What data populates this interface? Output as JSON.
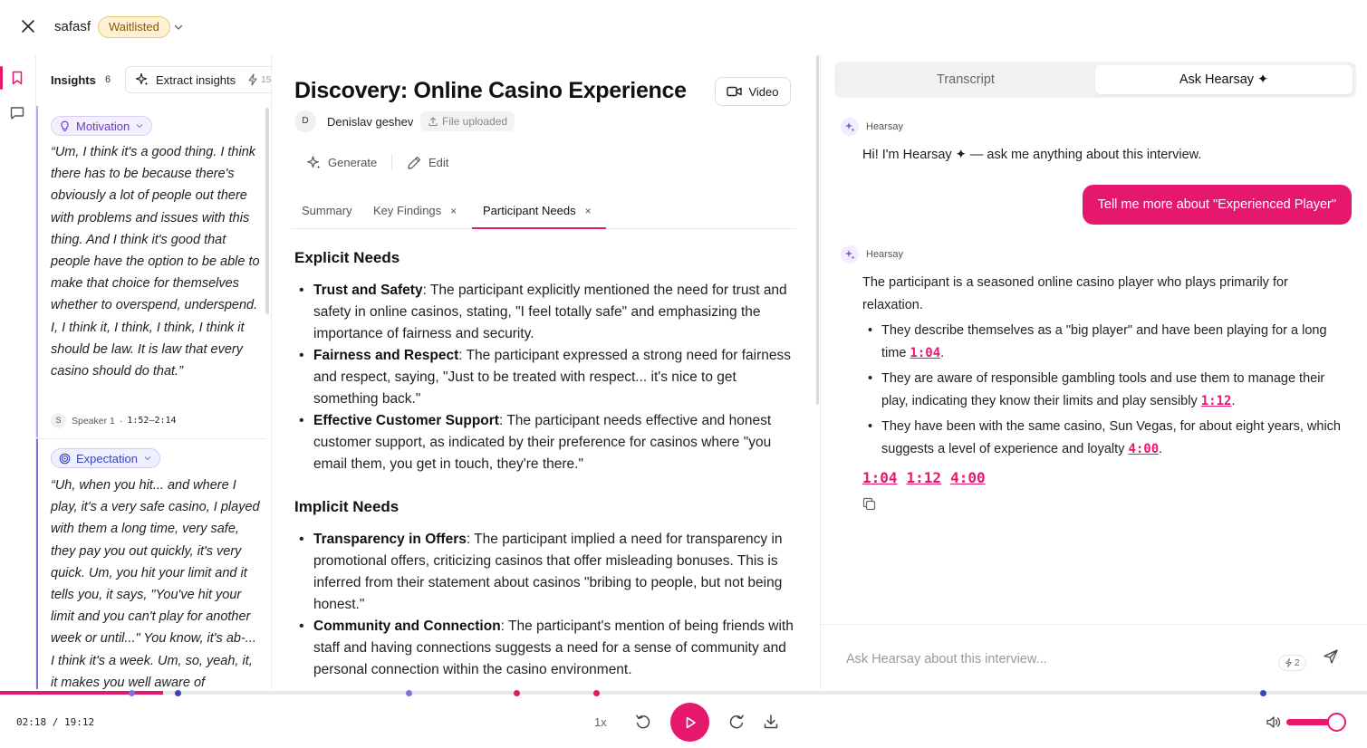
{
  "header": {
    "project_name": "safasf",
    "status": "Waitlisted"
  },
  "insights": {
    "title": "Insights",
    "count": "6",
    "extract_label": "Extract insights",
    "extract_credits": "15",
    "cards": [
      {
        "tag": "Motivation",
        "quote": "“Um, I think it's a good thing. I think there has to be because there's obviously a lot of people out there with problems and issues with this thing. And I think it's good that people have the option to be able to make that choice for themselves whether to overspend, underspend. I, I think it, I think, I think, I think it should be law. It is law that every casino should do that.”",
        "speaker_initial": "S",
        "speaker": "Speaker 1",
        "separator": "·",
        "time_range": "1:52–2:14"
      },
      {
        "tag": "Expectation",
        "quote": "“Uh, when you hit... and where I play, it's a very safe casino, I played with them a long time, very safe, they pay you out quickly, it's very quick. Um, you hit your limit and it tells you, it says, \"You've hit your limit and you can't play for another week or until...\" You know, it's ab-... I think it's a week. Um, so, yeah, it, it makes you well aware of"
      }
    ]
  },
  "document": {
    "title": "Discovery: Online Casino Experience",
    "video_label": "Video",
    "author_initial": "D",
    "author_name": "Denislav geshev",
    "file_status": "File uploaded",
    "generate_label": "Generate",
    "edit_label": "Edit",
    "tabs": [
      {
        "label": "Summary",
        "closable": false
      },
      {
        "label": "Key Findings",
        "closable": true
      },
      {
        "label": "Participant Needs",
        "closable": true
      }
    ],
    "tab_close_glyph": "×",
    "sections": [
      {
        "title": "Explicit Needs",
        "items": [
          {
            "term": "Trust and Safety",
            "text": ": The participant explicitly mentioned the need for trust and safety in online casinos, stating, \"I feel totally safe\" and emphasizing the importance of fairness and security."
          },
          {
            "term": "Fairness and Respect",
            "text": ": The participant expressed a strong need for fairness and respect, saying, \"Just to be treated with respect... it's nice to get something back.\""
          },
          {
            "term": "Effective Customer Support",
            "text": ": The participant needs effective and honest customer support, as indicated by their preference for casinos where \"you email them, you get in touch, they're there.\""
          }
        ]
      },
      {
        "title": "Implicit Needs",
        "items": [
          {
            "term": "Transparency in Offers",
            "text": ": The participant implied a need for transparency in promotional offers, criticizing casinos that offer misleading bonuses. This is inferred from their statement about casinos \"bribing to people, but not being honest.\""
          },
          {
            "term": "Community and Connection",
            "text": ": The participant's mention of being friends with staff and having connections suggests a need for a sense of community and personal connection within the casino environment."
          }
        ]
      }
    ]
  },
  "assistant": {
    "tab_transcript": "Transcript",
    "tab_ask": "Ask Hearsay ✦",
    "bot_name": "Hearsay",
    "greeting": "Hi! I'm Hearsay ✦ — ask me anything about this interview.",
    "user_message": "Tell me more about \"Experienced Player\"",
    "answer_intro": "The participant is a seasoned online casino player who plays primarily for relaxation.",
    "answer_points": [
      {
        "text": "They describe themselves as a \"big player\" and have been playing for a long time ",
        "ts": "1:04",
        "end": "."
      },
      {
        "text": "They are aware of responsible gambling tools and use them to manage their play, indicating they know their limits and play sensibly ",
        "ts": "1:12",
        "end": "."
      },
      {
        "text": "They have been with the same casino, Sun Vegas, for about eight years, which suggests a level of experience and loyalty ",
        "ts": "4:00",
        "end": "."
      }
    ],
    "timestamps": [
      "1:04",
      "1:12",
      "4:00"
    ],
    "input_placeholder": "Ask Hearsay about this interview...",
    "credits": "2"
  },
  "player": {
    "current_time": "02:18",
    "duration": "19:12",
    "time_separator": " / ",
    "speed": "1x",
    "progress_fraction": 0.119,
    "volume_fraction": 0.95,
    "marker_fractions": [
      {
        "at": 0.096,
        "color": "#7b74d6"
      },
      {
        "at": 0.13,
        "color": "#3c43b6"
      },
      {
        "at": 0.299,
        "color": "#7b74d6"
      },
      {
        "at": 0.378,
        "color": "#e6186d"
      },
      {
        "at": 0.436,
        "color": "#e6186d"
      },
      {
        "at": 0.924,
        "color": "#3c43b6"
      }
    ]
  },
  "colors": {
    "accent": "#e6186d",
    "waitlisted_bg": "#fdf0d3",
    "motivation": "#6a3dc9",
    "expectation": "#3c43b6"
  }
}
